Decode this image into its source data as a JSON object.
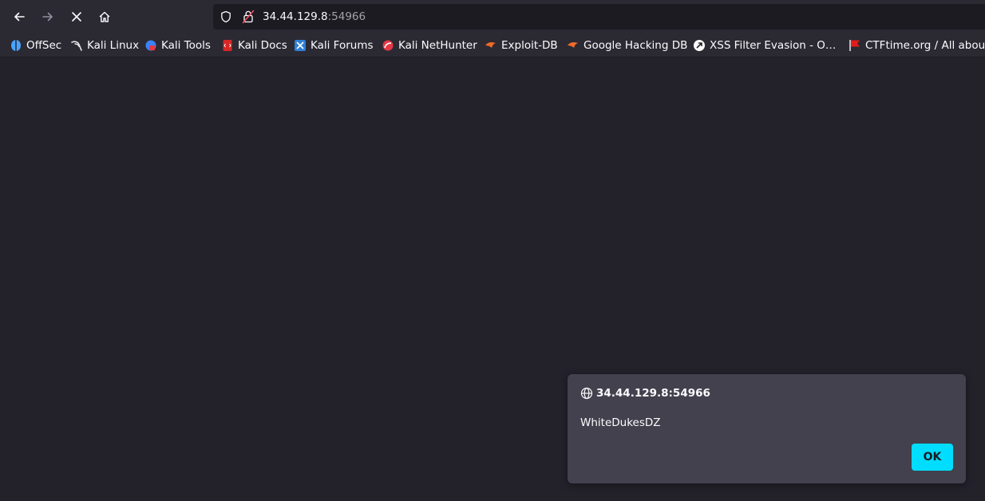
{
  "navigation": {
    "back_icon": "arrow-left-icon",
    "forward_icon": "arrow-right-icon",
    "stop_icon": "close-icon",
    "home_icon": "home-icon"
  },
  "urlbar": {
    "host": "34.44.129.8",
    "port": ":54966"
  },
  "bookmarks": [
    {
      "label": "OffSec",
      "color": "#4aa3ff"
    },
    {
      "label": "Kali Linux",
      "color": "#e6e6e6"
    },
    {
      "label": "Kali Tools",
      "color": "#3b82f6"
    },
    {
      "label": "Kali Docs",
      "color": "#d62828"
    },
    {
      "label": "Kali Forums",
      "color": "#2f7fd8"
    },
    {
      "label": "Kali NetHunter",
      "color": "#e63946"
    },
    {
      "label": "Exploit-DB",
      "color": "#f06a28"
    },
    {
      "label": "Google Hacking DB",
      "color": "#f06a28"
    },
    {
      "label": "XSS Filter Evasion - O…",
      "color": "#ffffff"
    },
    {
      "label": "CTFtime.org / All abou…",
      "color": "#e21b1b"
    }
  ],
  "dialog": {
    "origin": "34.44.129.8:54966",
    "message": "WhiteDukesDZ",
    "ok_label": "OK"
  },
  "colors": {
    "accent": "#00ddff",
    "page_bg": "#23222b",
    "toolbar_bg": "#2b2a33",
    "dialog_bg": "#42414d"
  }
}
